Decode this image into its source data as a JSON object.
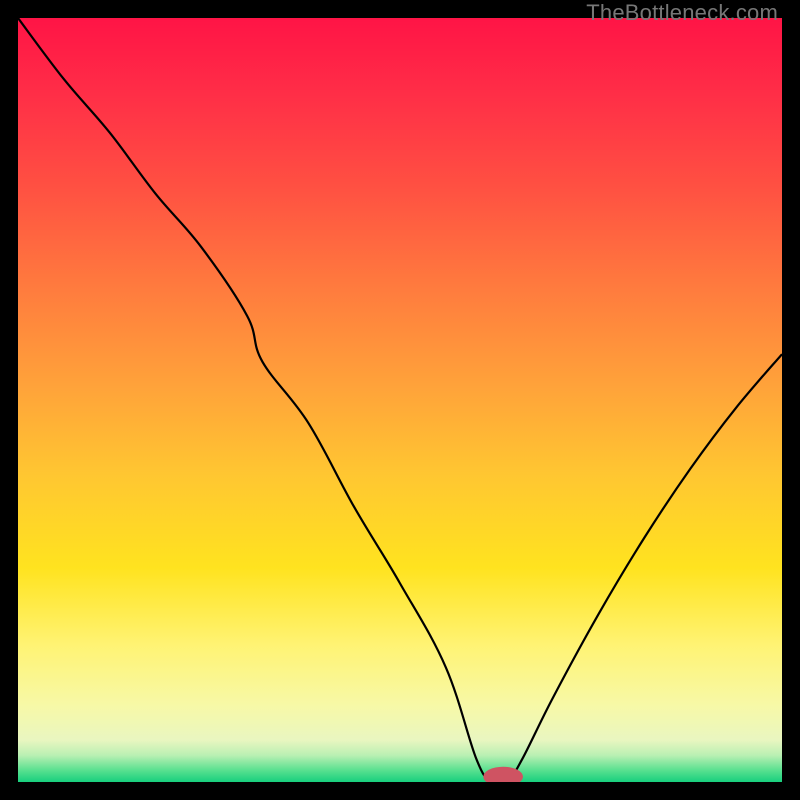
{
  "watermark": {
    "text": "TheBottleneck.com"
  },
  "chart_data": {
    "type": "line",
    "title": "",
    "xlabel": "",
    "ylabel": "",
    "xlim": [
      0,
      100
    ],
    "ylim": [
      0,
      100
    ],
    "grid": false,
    "curve": {
      "name": "bottleneck-curve",
      "color": "#000000",
      "x": [
        0,
        6,
        12,
        18,
        24,
        30,
        32,
        38,
        44,
        50,
        56,
        60,
        62,
        64,
        66,
        70,
        76,
        82,
        88,
        94,
        100
      ],
      "y": [
        100,
        92,
        85,
        77,
        70,
        61,
        55,
        47,
        36,
        26,
        15,
        3,
        0,
        0,
        3,
        11,
        22,
        32,
        41,
        49,
        56
      ]
    },
    "marker": {
      "name": "optimal-marker",
      "color": "#cf5362",
      "x": 63.5,
      "y": 0.7,
      "rx": 2.6,
      "ry": 1.3
    },
    "background_gradient": {
      "stops": [
        {
          "offset": 0.0,
          "color": "#ff1446"
        },
        {
          "offset": 0.1,
          "color": "#ff2e47"
        },
        {
          "offset": 0.22,
          "color": "#ff5042"
        },
        {
          "offset": 0.35,
          "color": "#ff7a3e"
        },
        {
          "offset": 0.48,
          "color": "#ffa23a"
        },
        {
          "offset": 0.6,
          "color": "#ffc731"
        },
        {
          "offset": 0.72,
          "color": "#ffe31f"
        },
        {
          "offset": 0.82,
          "color": "#fff373"
        },
        {
          "offset": 0.9,
          "color": "#f7f9a7"
        },
        {
          "offset": 0.945,
          "color": "#e9f6c0"
        },
        {
          "offset": 0.965,
          "color": "#baf0b3"
        },
        {
          "offset": 0.985,
          "color": "#57e08f"
        },
        {
          "offset": 1.0,
          "color": "#18cf7e"
        }
      ]
    }
  }
}
